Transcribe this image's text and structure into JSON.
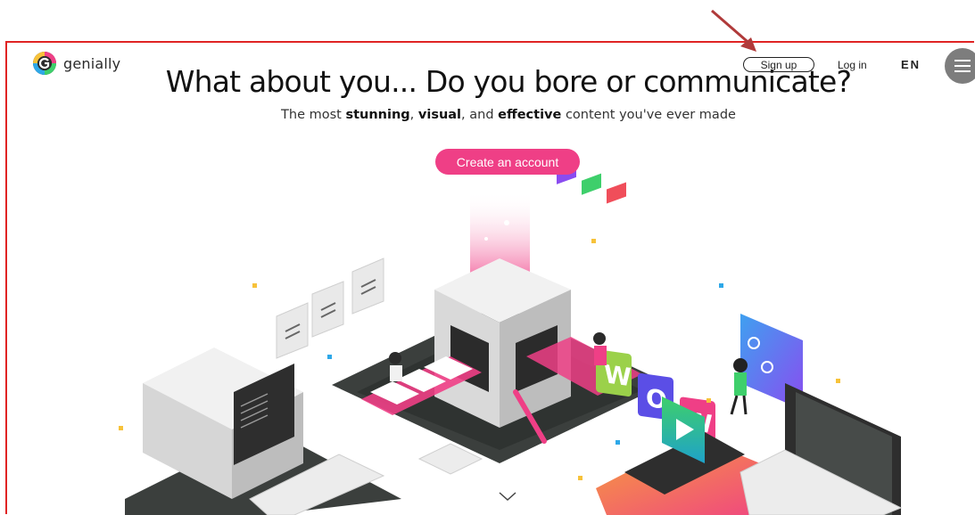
{
  "brand": {
    "name": "genially"
  },
  "nav": {
    "signup_label": "Sign up",
    "login_label": "Log in",
    "language": "EN"
  },
  "hero": {
    "headline": "What about you... Do you bore or communicate?",
    "subline": {
      "part1": "The most ",
      "bold1": "stunning",
      "part2": ", ",
      "bold2": "visual",
      "part3": ", and ",
      "bold3": "effective",
      "part4": " content you've ever made"
    },
    "cta_label": "Create an account"
  },
  "illustration": {
    "wow_letters": [
      "W",
      "O",
      "W"
    ]
  },
  "colors": {
    "accent": "#ef3f86",
    "annotation": "#b03a3a",
    "frame": "#e02424"
  },
  "icons": {
    "menu": "hamburger-icon",
    "scroll": "chevron-down-icon",
    "annotation": "arrow-annotation"
  }
}
